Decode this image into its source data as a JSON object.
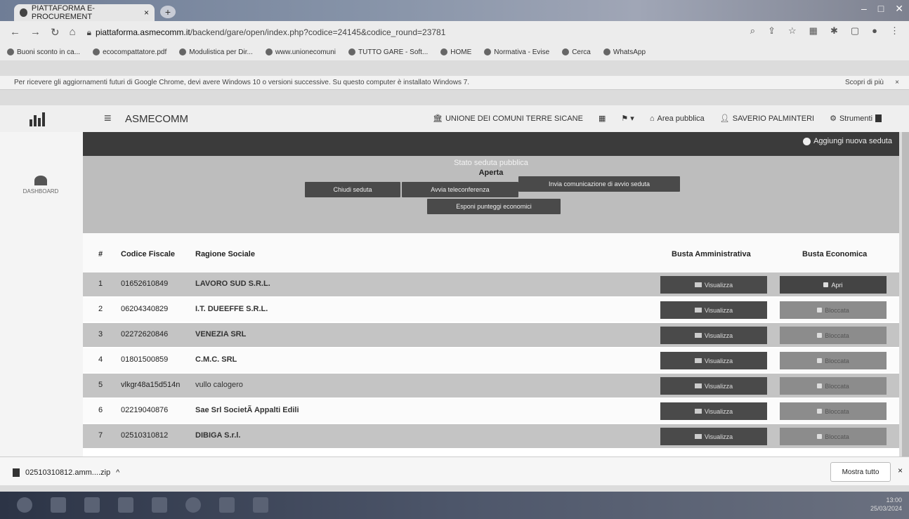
{
  "browser": {
    "tab_title": "PIATTAFORMA E-PROCUREMENT",
    "tab_close": "×",
    "new_tab": "+",
    "url_domain": "piattaforma.asmecomm.it",
    "url_path": "/backend/gare/open/index.php?codice=24145&codice_round=23781",
    "bookmarks": [
      "Buoni sconto in ca...",
      "ecocompattatore.pdf",
      "Modulistica per Dir...",
      "www.unionecomuni",
      "TUTTO GARE - Soft...",
      "HOME",
      "Normativa - Evise",
      "Cerca",
      "WhatsApp"
    ],
    "info_message": "Per ricevere gli aggiornamenti futuri di Google Chrome, devi avere Windows 10 o versioni successive. Su questo computer è installato Windows 7.",
    "info_more": "Scopri di più",
    "info_close": "×"
  },
  "app": {
    "brand": "ASMECOMM",
    "hamburger": "≡",
    "nav": {
      "union": "UNIONE DEI COMUNI TERRE SICANE",
      "area": "Area pubblica",
      "user": "SAVERIO PALMINTERI",
      "tools": "Strumenti"
    },
    "sidebar_dashboard": "DASHBOARD",
    "add_session": "Aggiungi nuova seduta",
    "session": {
      "status_label": "Stato seduta pubblica",
      "status_value": "Aperta",
      "close_btn": "Chiudi seduta",
      "teleconf_btn": "Avvia teleconferenza",
      "notify_btn": "Invia comunicazione di avvio seduta",
      "scores_btn": "Esponi punteggi economici"
    }
  },
  "table": {
    "headers": {
      "num": "#",
      "cf": "Codice Fiscale",
      "rs": "Ragione Sociale",
      "admin": "Busta Amministrativa",
      "eco": "Busta Economica"
    },
    "view_label": "Visualizza",
    "rows": [
      {
        "num": "1",
        "cf": "01652610849",
        "rs": "LAVORO SUD S.R.L.",
        "eco": "Apri"
      },
      {
        "num": "2",
        "cf": "06204340829",
        "rs": "I.T. DUEEFFE S.R.L.",
        "eco": "Bloccata"
      },
      {
        "num": "3",
        "cf": "02272620846",
        "rs": "VENEZIA SRL",
        "eco": "Bloccata"
      },
      {
        "num": "4",
        "cf": "01801500859",
        "rs": "C.M.C. SRL",
        "eco": "Bloccata"
      },
      {
        "num": "5",
        "cf": "vlkgr48a15d514n",
        "rs": "vullo calogero",
        "eco": "Bloccata"
      },
      {
        "num": "6",
        "cf": "02219040876",
        "rs": "Sae Srl SocietÃ  Appalti Edili",
        "eco": "Bloccata"
      },
      {
        "num": "7",
        "cf": "02510310812",
        "rs": "DIBIGA S.r.l.",
        "eco": "Bloccata"
      }
    ]
  },
  "downloads": {
    "file": "02510310812.amm....zip",
    "caret": "^",
    "show_all": "Mostra tutto",
    "close": "×"
  },
  "taskbar": {
    "time": "13:00",
    "date": "25/03/2024"
  }
}
